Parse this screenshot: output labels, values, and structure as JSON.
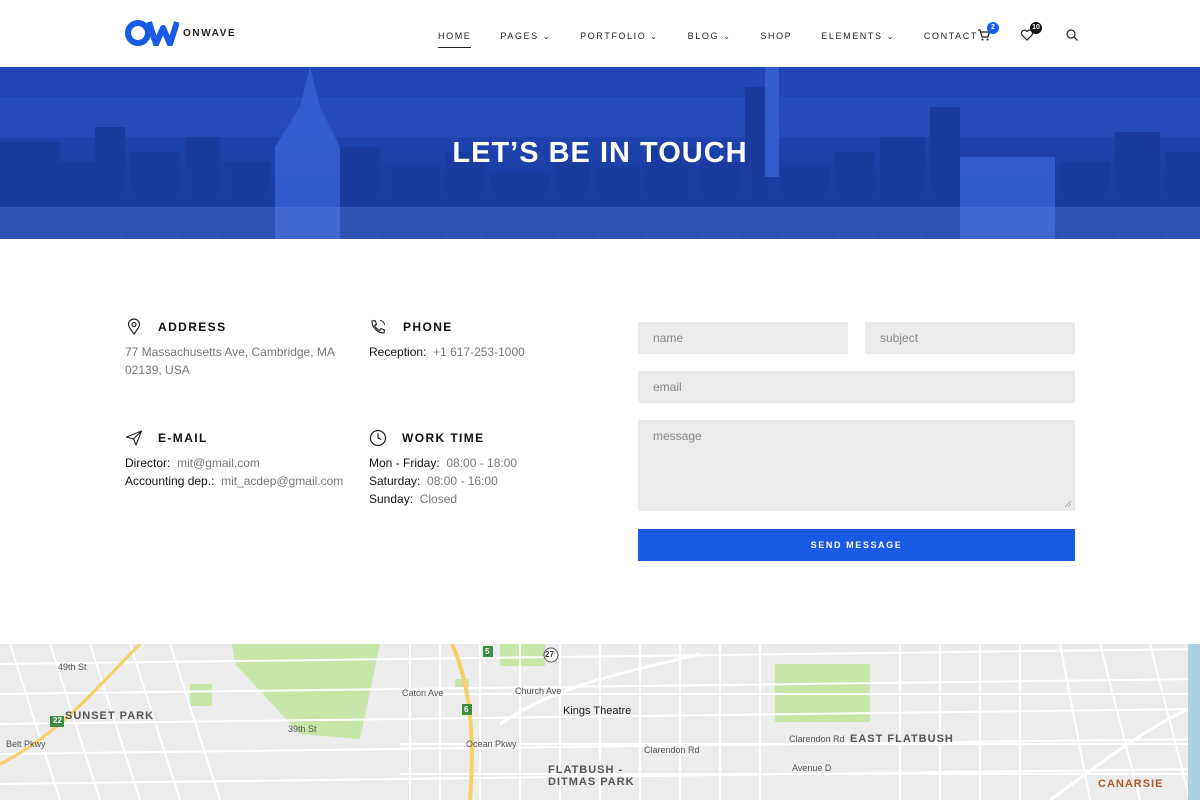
{
  "header": {
    "logo_text": "ONWAVE",
    "nav": [
      {
        "label": "HOME",
        "chevron": false
      },
      {
        "label": "PAGES",
        "chevron": true
      },
      {
        "label": "PORTFOLIO",
        "chevron": true
      },
      {
        "label": "BLOG",
        "chevron": true
      },
      {
        "label": "SHOP",
        "chevron": false
      },
      {
        "label": "ELEMENTS",
        "chevron": true
      },
      {
        "label": "CONTACT",
        "chevron": false
      }
    ],
    "cart_count": "2",
    "wishlist_count": "10",
    "icons": [
      "cart-icon",
      "heart-icon",
      "search-icon"
    ]
  },
  "hero": {
    "title": "LET’S BE IN TOUCH"
  },
  "contact": {
    "address": {
      "title": "ADDRESS",
      "line1": "77 Massachusetts Ave, Cambridge, MA",
      "line2": "02139, USA"
    },
    "phone": {
      "title": "PHONE",
      "label": "Reception:",
      "value": "+1 617-253-1000"
    },
    "email": {
      "title": "E-MAIL",
      "director_label": "Director:",
      "director_value": "mit@gmail.com",
      "accounting_label": "Accounting dep.:",
      "accounting_value": "mit_acdep@gmail.com"
    },
    "worktime": {
      "title": "WORK TIME",
      "weekday_label": "Mon - Friday:",
      "weekday_value": "08:00 - 18:00",
      "saturday_label": "Saturday:",
      "saturday_value": "08:00 - 16:00",
      "sunday_label": "Sunday:",
      "sunday_value": "Closed"
    }
  },
  "form": {
    "name_placeholder": "name",
    "subject_placeholder": "subject",
    "email_placeholder": "email",
    "message_placeholder": "message",
    "send_label": "SEND MESSAGE"
  },
  "map": {
    "labels": {
      "sunset_park": "SUNSET PARK",
      "kings_theatre": "Kings Theatre",
      "east_flatbush": "EAST FLATBUSH",
      "flatbush_line1": "FLATBUSH -",
      "flatbush_line2": "DITMAS PARK",
      "canarsie": "CANARSIE",
      "caton_ave": "Caton Ave",
      "church_ave": "Church Ave",
      "clarendon_rd": "Clarendon Rd",
      "clarendon_rd2": "Clarendon Rd",
      "avenue_d": "Avenue D",
      "ocean_pkwy": "Ocean Pkwy",
      "belt_pkwy": "Belt Pkwy",
      "street_49th": "49th St",
      "street_39th": "39th St",
      "route_22": "22",
      "route_27": "27",
      "route_5": "5",
      "route_6": "6"
    }
  },
  "colors": {
    "accent": "#1a5be6",
    "hero_blue": "#1d46b8",
    "field_bg": "#ebebeb",
    "park_green": "#c8e6a8"
  }
}
